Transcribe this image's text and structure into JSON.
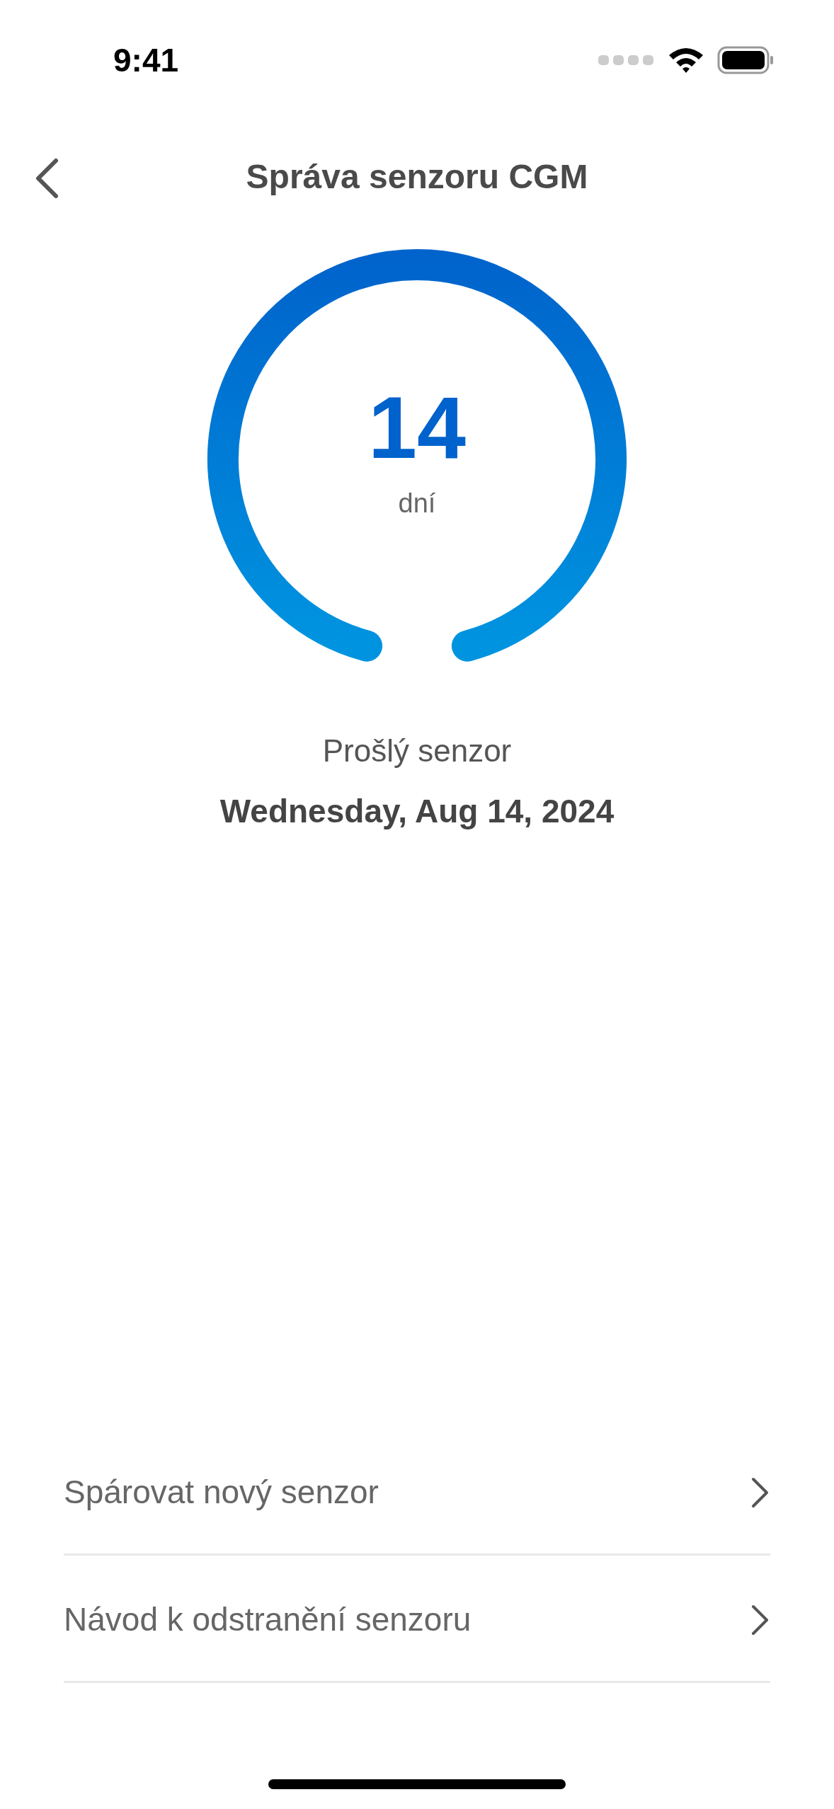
{
  "status_bar": {
    "time": "9:41"
  },
  "header": {
    "title": "Správa senzoru CGM"
  },
  "gauge": {
    "value": "14",
    "unit": "dní"
  },
  "sensor": {
    "label": "Prošlý senzor",
    "date": "Wednesday, Aug 14, 2024"
  },
  "menu_items": [
    {
      "label": "Spárovat nový senzor"
    },
    {
      "label": "Návod k odstranění senzoru"
    }
  ]
}
